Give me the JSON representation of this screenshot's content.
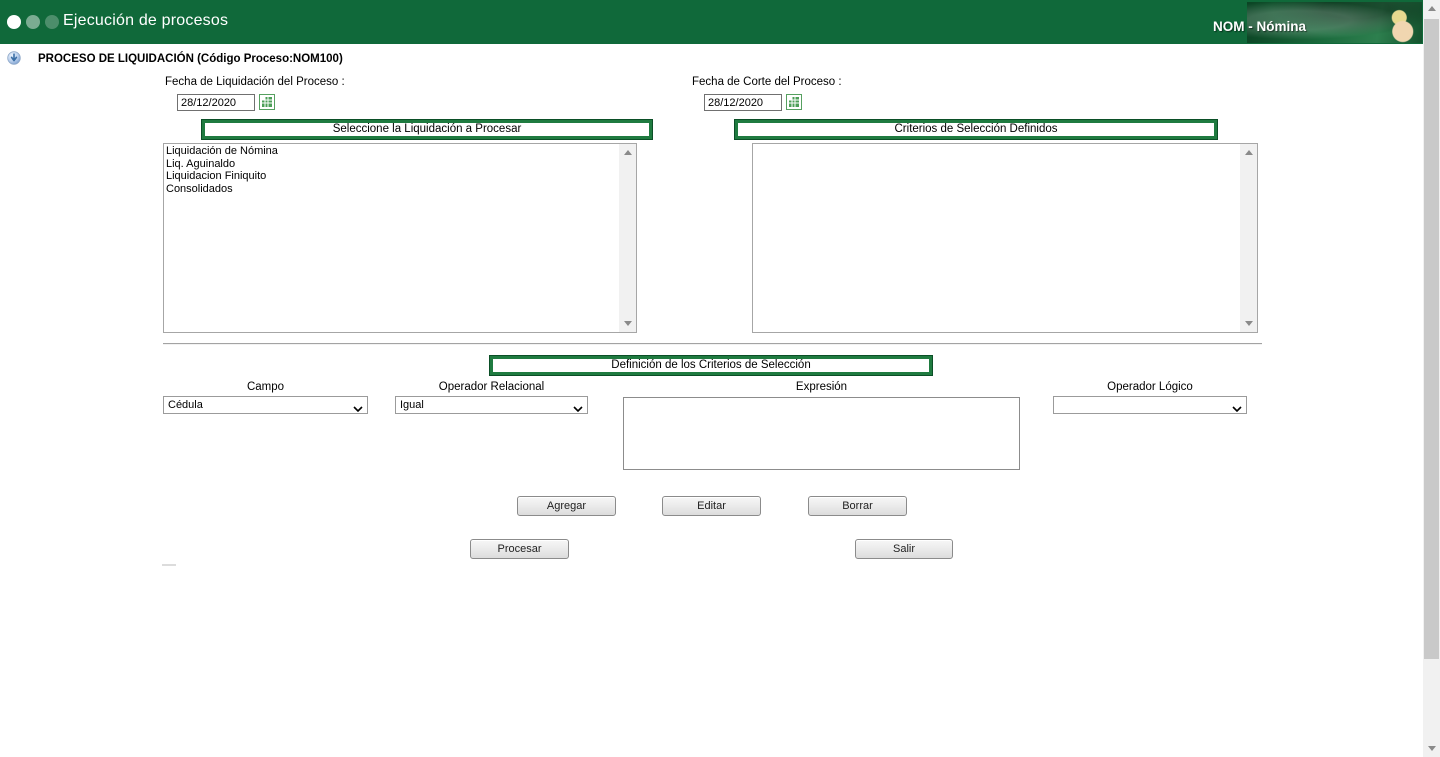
{
  "header": {
    "title": "Ejecución de procesos",
    "app_name": "NOM - Nómina"
  },
  "page_title": "PROCESO DE LIQUIDACIÓN (Código Proceso:NOM100)",
  "form": {
    "fecha_liquidacion": {
      "label": "Fecha de Liquidación del Proceso :",
      "value": "28/12/2020"
    },
    "fecha_corte": {
      "label": "Fecha de Corte del Proceso :",
      "value": "28/12/2020"
    },
    "liquidaciones": {
      "header": "Seleccione la Liquidación a Procesar",
      "items": [
        "Liquidación de Nómina",
        "Liq. Aguinaldo",
        "Liquidacion Finiquito",
        "Consolidados"
      ]
    },
    "criterios_definidos": {
      "header": "Criterios de Selección Definidos",
      "items": []
    },
    "definicion_criterios": {
      "header": "Definición de los Criterios de Selección",
      "campo": {
        "label": "Campo",
        "value": "Cédula"
      },
      "operador_relacional": {
        "label": "Operador Relacional",
        "value": "Igual"
      },
      "expresion": {
        "label": "Expresión",
        "value": ""
      },
      "operador_logico": {
        "label": "Operador Lógico",
        "value": ""
      }
    }
  },
  "buttons": {
    "agregar": "Agregar",
    "editar": "Editar",
    "borrar": "Borrar",
    "procesar": "Procesar",
    "salir": "Salir"
  },
  "icons": {
    "info-icon": "ℹ",
    "calendar-icon": "▦",
    "chevron-down-icon": "⌄",
    "scroll-up-icon": "▲",
    "scroll-down-icon": "▼"
  },
  "colors": {
    "header_green": "#10693a",
    "section_border_green": "#1f7b40",
    "calendar_green": "#4d9f58"
  }
}
